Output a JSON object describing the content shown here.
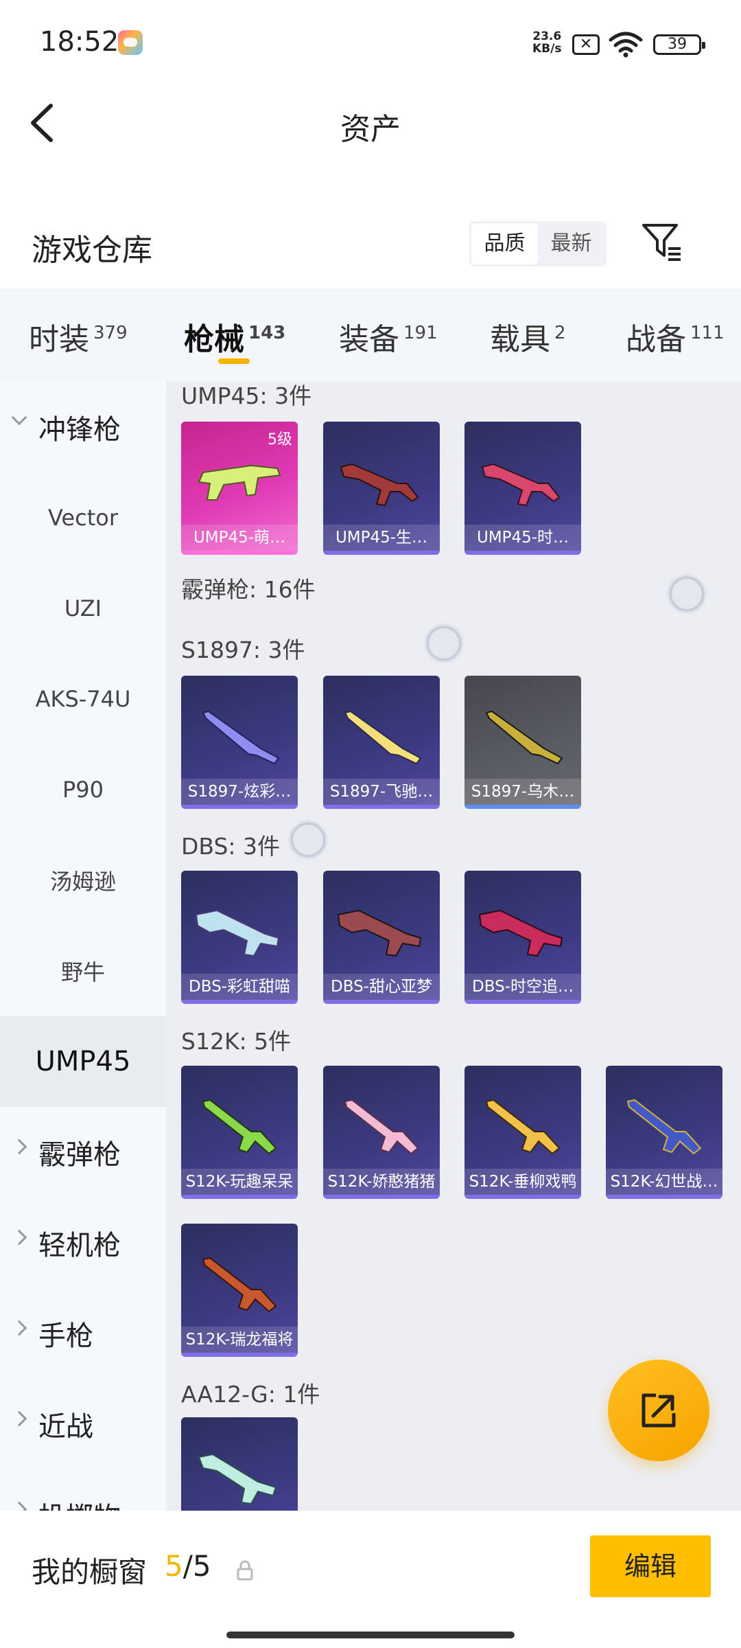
{
  "status_bar": {
    "time": "18:52",
    "net_speed_value": "23.6",
    "net_speed_unit": "KB/s",
    "battery": "39"
  },
  "header": {
    "title": "资产"
  },
  "warehouse": {
    "title": "游戏仓库",
    "sort_options": [
      "品质",
      "最新"
    ],
    "sort_selected": "品质"
  },
  "tabs": [
    {
      "label": "时装",
      "count": "379"
    },
    {
      "label": "枪械",
      "count": "143"
    },
    {
      "label": "装备",
      "count": "191"
    },
    {
      "label": "载具",
      "count": "2"
    },
    {
      "label": "战备",
      "count": "111"
    }
  ],
  "active_tab": "枪械",
  "sidebar": {
    "items": [
      {
        "label": "冲锋枪",
        "type": "group",
        "expanded": true
      },
      {
        "label": "Vector",
        "type": "sub"
      },
      {
        "label": "UZI",
        "type": "sub"
      },
      {
        "label": "AKS-74U",
        "type": "sub"
      },
      {
        "label": "P90",
        "type": "sub"
      },
      {
        "label": "汤姆逊",
        "type": "sub"
      },
      {
        "label": "野牛",
        "type": "sub"
      },
      {
        "label": "UMP45",
        "type": "sub",
        "selected": true
      },
      {
        "label": "霰弹枪",
        "type": "group"
      },
      {
        "label": "轻机枪",
        "type": "group"
      },
      {
        "label": "手枪",
        "type": "group"
      },
      {
        "label": "近战",
        "type": "group"
      },
      {
        "label": "投掷物",
        "type": "group"
      }
    ]
  },
  "content": {
    "groups": [
      {
        "title": "UMP45: 3件",
        "items": [
          {
            "name": "UMP45-萌…",
            "tier": "5级",
            "rarity": "pink"
          },
          {
            "name": "UMP45-生…",
            "rarity": "purple"
          },
          {
            "name": "UMP45-时…",
            "rarity": "purple"
          }
        ]
      },
      {
        "title": "霰弹枪: 16件",
        "items": []
      },
      {
        "title": "S1897: 3件",
        "items": [
          {
            "name": "S1897-炫彩…",
            "rarity": "purple"
          },
          {
            "name": "S1897-飞驰…",
            "rarity": "purple"
          },
          {
            "name": "S1897-乌木…",
            "rarity": "grey"
          }
        ]
      },
      {
        "title": "DBS: 3件",
        "items": [
          {
            "name": "DBS-彩虹甜喵",
            "rarity": "purple"
          },
          {
            "name": "DBS-甜心亚梦",
            "rarity": "purple"
          },
          {
            "name": "DBS-时空追…",
            "rarity": "purple"
          }
        ]
      },
      {
        "title": "S12K: 5件",
        "items": [
          {
            "name": "S12K-玩趣呆呆",
            "rarity": "purple"
          },
          {
            "name": "S12K-娇憨猪猪",
            "rarity": "purple"
          },
          {
            "name": "S12K-垂柳戏鸭",
            "rarity": "purple"
          },
          {
            "name": "S12K-幻世战…",
            "rarity": "purple"
          },
          {
            "name": "S12K-瑞龙福将",
            "rarity": "purple"
          }
        ]
      },
      {
        "title": "AA12-G: 1件",
        "items": [
          {
            "name": "",
            "rarity": "purple"
          }
        ]
      }
    ]
  },
  "bottom_bar": {
    "label": "我的橱窗",
    "current": "5",
    "total": "/5",
    "edit_label": "编辑"
  },
  "colors": {
    "accent": "#f5b400",
    "rarity_purple": "#3d3a82",
    "rarity_pink": "#e03ab4",
    "rarity_grey": "#5a5c63"
  }
}
